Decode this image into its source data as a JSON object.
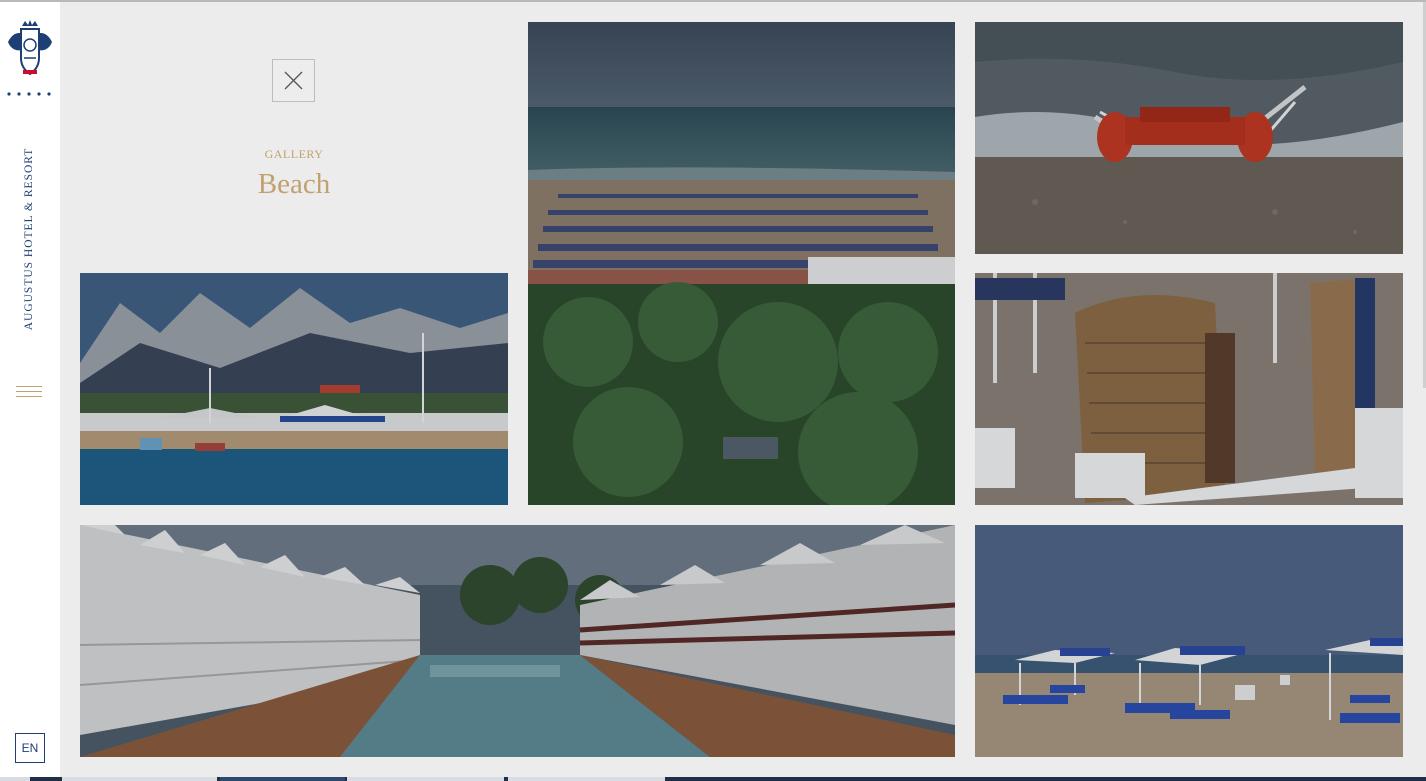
{
  "sidebar": {
    "logo_icon": "augustus-hotel-crest-logo",
    "brand_text": "AUGUSTUS HOTEL & RESORT",
    "menu_icon": "hamburger-menu-icon",
    "language": "EN"
  },
  "gallery": {
    "label": "GALLERY",
    "title": "Beach",
    "close_icon": "close-icon"
  },
  "photos": [
    {
      "subject": "beach-aerial-view"
    },
    {
      "subject": "pedalo-on-shore"
    },
    {
      "subject": "mountains-and-beach-club"
    },
    {
      "subject": "wicker-beach-chairs"
    },
    {
      "subject": "cabanas-and-pool"
    },
    {
      "subject": "beach-umbrellas-and-loungers"
    }
  ],
  "colors": {
    "gold": "#c2a171",
    "navy": "#1d3f73",
    "background": "#ececec",
    "sidebar": "#ffffff"
  }
}
